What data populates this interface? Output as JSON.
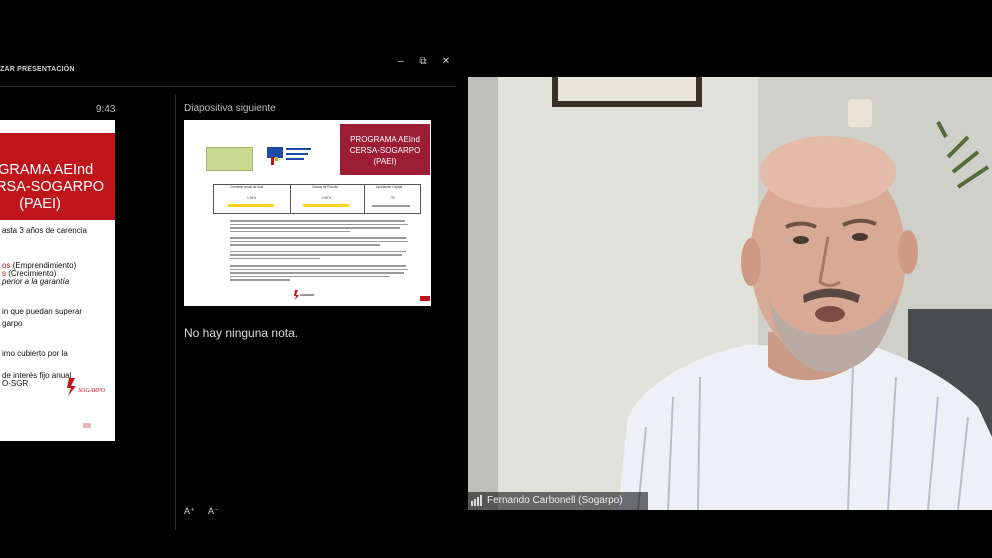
{
  "presenter": {
    "window_title": "ZAR PRESENTACIÓN",
    "elapsed_time": "9:43",
    "next_slide_label": "Diapositiva siguiente",
    "notes_text": "No hay ninguna nota.",
    "font_increase_icon": "A⁺",
    "font_decrease_icon": "A⁻",
    "window_controls": {
      "minimize": "–",
      "restore": "⧉",
      "close": "✕"
    }
  },
  "current_slide": {
    "title": "OGRAMA AEInd\nCERSA-SOGARPO\n(PAEI)",
    "bullets": [
      {
        "text": "asta 3 años de carencia"
      },
      {
        "red": "os ",
        "text": "(Emprendimiento)"
      },
      {
        "red": "s ",
        "text": "(Crecimiento)"
      },
      {
        "text": "perior a la  garantía"
      },
      {
        "text": "in que puedan superar"
      },
      {
        "text": "garpo"
      },
      {
        "text": "imo cubierto por la"
      },
      {
        "text": "de interés fijo  anual"
      },
      {
        "text": "O-SGR"
      }
    ],
    "logo_text": "SOGARPO",
    "accent_color": "#c0141b"
  },
  "next_slide": {
    "title": "PROGRAMA  AEInd\nCERSA-SOGARPO\n(PAEI)",
    "title_bg": "#9c1c34",
    "table_headers": [
      "Comisión anual de Aval",
      "Gastos de Estudio",
      "Aportación Capital"
    ],
    "table_values": [
      "1,35%",
      "0,50%",
      "7%"
    ],
    "highlight_color": "#ffd320"
  },
  "video": {
    "participant_name": "Fernando Carbonell (Sogarpo)"
  }
}
